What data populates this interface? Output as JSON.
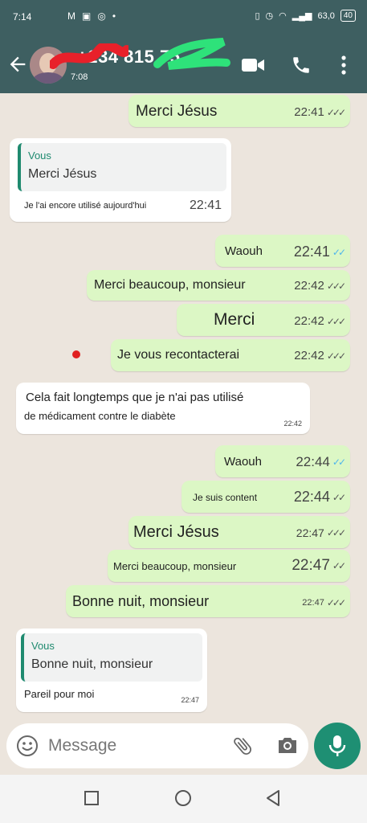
{
  "status_bar": {
    "time": "7:14",
    "battery": "40",
    "net_speed": "63,0"
  },
  "header": {
    "contact_name": "+234 815 75",
    "contact_sub": "7:08"
  },
  "messages": [
    {
      "text": "Merci Jésus",
      "time": "22:41"
    },
    {
      "quote_author": "Vous",
      "quote_text": "Merci Jésus",
      "text": "Je l'ai encore utilisé aujourd'hui",
      "time": "22:41"
    },
    {
      "text": "Waouh",
      "time": "22:41"
    },
    {
      "text": "Merci beaucoup, monsieur",
      "time": "22:42"
    },
    {
      "text": "Merci",
      "time": "22:42"
    },
    {
      "text": "Je vous recontacterai",
      "time": "22:42"
    },
    {
      "text_line1": "Cela fait longtemps que je n'ai pas utilisé",
      "text_line2": "de médicament contre le diabète",
      "time": "22:42"
    },
    {
      "text": "Waouh",
      "time": "22:44"
    },
    {
      "text": "Je suis content",
      "time": "22:44"
    },
    {
      "text": "Merci Jésus",
      "time": "22:47"
    },
    {
      "text": "Merci beaucoup, monsieur",
      "time": "22:47"
    },
    {
      "text": "Bonne nuit, monsieur",
      "time": "22:47"
    },
    {
      "quote_author": "Vous",
      "quote_text": "Bonne nuit, monsieur",
      "text": "Pareil pour moi",
      "time": "22:47"
    }
  ],
  "input": {
    "placeholder": "Message"
  },
  "ticks": {
    "read": "✓✓",
    "delivered": "✓✓✓"
  },
  "colors": {
    "header": "#3e5f61",
    "outgoing": "#dcf7c5",
    "accent": "#1e8f73",
    "read_ticks": "#4fb6ec"
  }
}
